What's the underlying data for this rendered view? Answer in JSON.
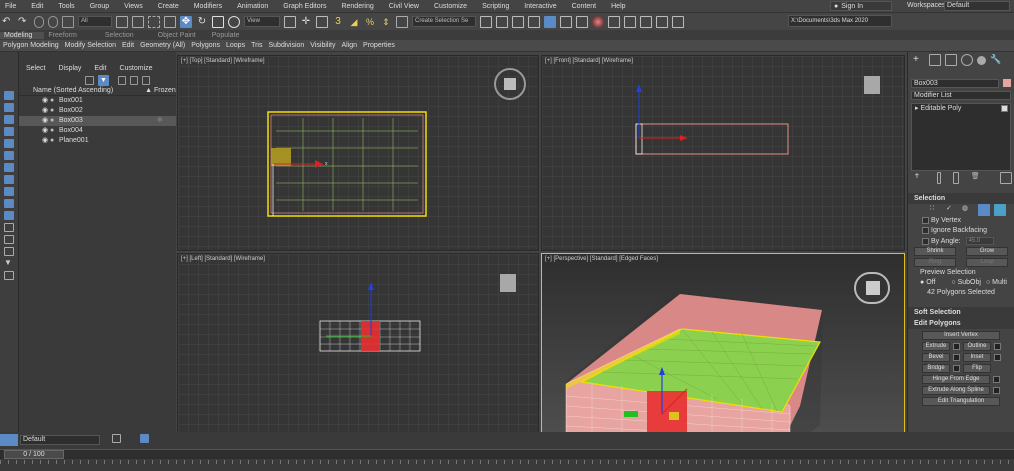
{
  "menu": {
    "items": [
      "File",
      "Edit",
      "Tools",
      "Group",
      "Views",
      "Create",
      "Modifiers",
      "Animation",
      "Graph Editors",
      "Rendering",
      "Civil View",
      "Customize",
      "Scripting",
      "Interactive",
      "Content",
      "Help"
    ],
    "sign_in": "Sign In",
    "workspaces_label": "Workspaces:",
    "workspace_value": "Default"
  },
  "toolbar": {
    "filter_value": "All",
    "refcoord_value": "View",
    "selection_set_placeholder": "Create Selection Se",
    "path": "X:\\Documents\\3ds Max 2020"
  },
  "ribbon": {
    "tabs": [
      "Modeling",
      "Freeform",
      "Selection",
      "Object Paint",
      "Populate"
    ],
    "subtabs": [
      "Polygon Modeling",
      "Modify Selection",
      "Edit",
      "Geometry (All)",
      "Polygons",
      "Loops",
      "Tris",
      "Subdivision",
      "Visibility",
      "Align",
      "Properties"
    ]
  },
  "scene": {
    "tabs": [
      "Select",
      "Display",
      "Edit",
      "Customize"
    ],
    "header_name": "Name (Sorted Ascending)",
    "header_frozen": "▲ Frozen",
    "objects": [
      "Box001",
      "Box002",
      "Box003",
      "Box004",
      "Plane001"
    ],
    "layer": "Default"
  },
  "viewports": {
    "top": "[+] [Top] [Standard] [Wireframe]",
    "front": "[+] [Front] [Standard] [Wireframe]",
    "left": "[+] [Left] [Standard] [Wireframe]",
    "persp": "[+] [Perspective] [Standard] [Edged Faces]"
  },
  "cmd": {
    "object_name": "Box003",
    "modifier_list": "Modifier List",
    "stack_item": "Editable Poly",
    "selection": {
      "title": "Selection",
      "by_vertex": "By Vertex",
      "ignore_backfacing": "Ignore Backfacing",
      "by_angle": "By Angle:",
      "angle_value": "45.0",
      "shrink": "Shrink",
      "grow": "Grow",
      "ring": "Ring",
      "loop": "Loop",
      "preview_title": "Preview Selection",
      "off": "Off",
      "subobj": "SubObj",
      "multi": "Multi",
      "status": "42 Polygons Selected"
    },
    "soft_selection": "Soft Selection",
    "edit_polygons": "Edit Polygons",
    "buttons": {
      "insert_vertex": "Insert Vertex",
      "extrude": "Extrude",
      "outline": "Outline",
      "bevel": "Bevel",
      "inset": "Inset",
      "bridge": "Bridge",
      "flip": "Flip",
      "hinge": "Hinge From Edge",
      "extrude_spline": "Extrude Along Spline",
      "edit_tri": "Edit Triangulation"
    }
  },
  "timeline": {
    "frame": "0 / 100"
  },
  "colors": {
    "accent": "#5b8ac4",
    "selection_yellow": "#f0e000",
    "box_pink": "#e8908c",
    "plane_green": "#8cd050"
  }
}
